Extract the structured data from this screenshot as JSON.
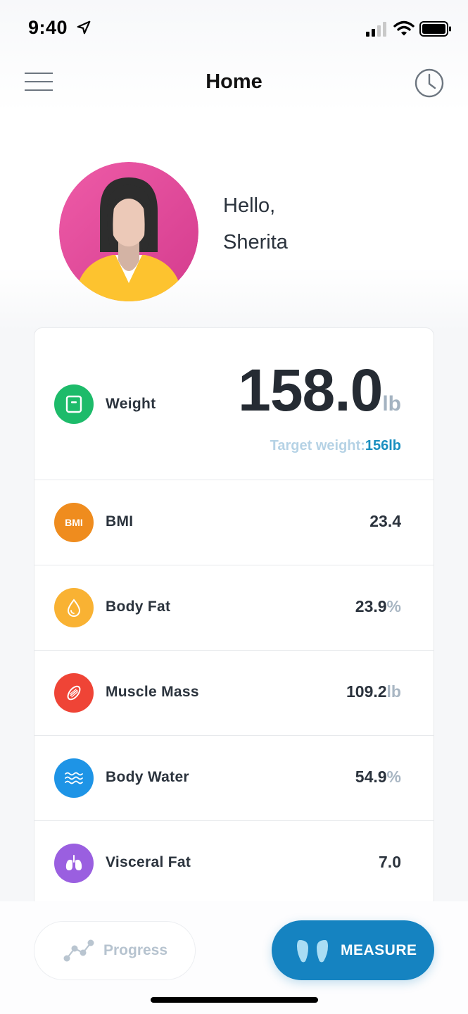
{
  "status_bar": {
    "time": "9:40"
  },
  "nav": {
    "title": "Home"
  },
  "profile": {
    "greeting_line1": "Hello,",
    "greeting_line2": "Sherita"
  },
  "weight": {
    "label": "Weight",
    "value": "158.0",
    "unit": "lb",
    "target_label": "Target weight:",
    "target_value": "156lb",
    "icon": "scale-icon",
    "color": "#1dbb6a"
  },
  "metrics": [
    {
      "label": "BMI",
      "value": "23.4",
      "unit": "",
      "icon": "bmi-icon",
      "icon_text": "BMI",
      "color": "#ef8c1e"
    },
    {
      "label": "Body Fat",
      "value": "23.9",
      "unit": "%",
      "icon": "droplet-icon",
      "color": "#f9b233"
    },
    {
      "label": "Muscle Mass",
      "value": "109.2",
      "unit": "lb",
      "icon": "muscle-icon",
      "color": "#ef4436"
    },
    {
      "label": "Body Water",
      "value": "54.9",
      "unit": "%",
      "icon": "water-waves-icon",
      "color": "#1e94e6"
    },
    {
      "label": "Visceral Fat",
      "value": "7.0",
      "unit": "",
      "icon": "lungs-icon",
      "color": "#9a5fe0"
    }
  ],
  "bottom": {
    "progress_label": "Progress",
    "measure_label": "MEASURE"
  }
}
